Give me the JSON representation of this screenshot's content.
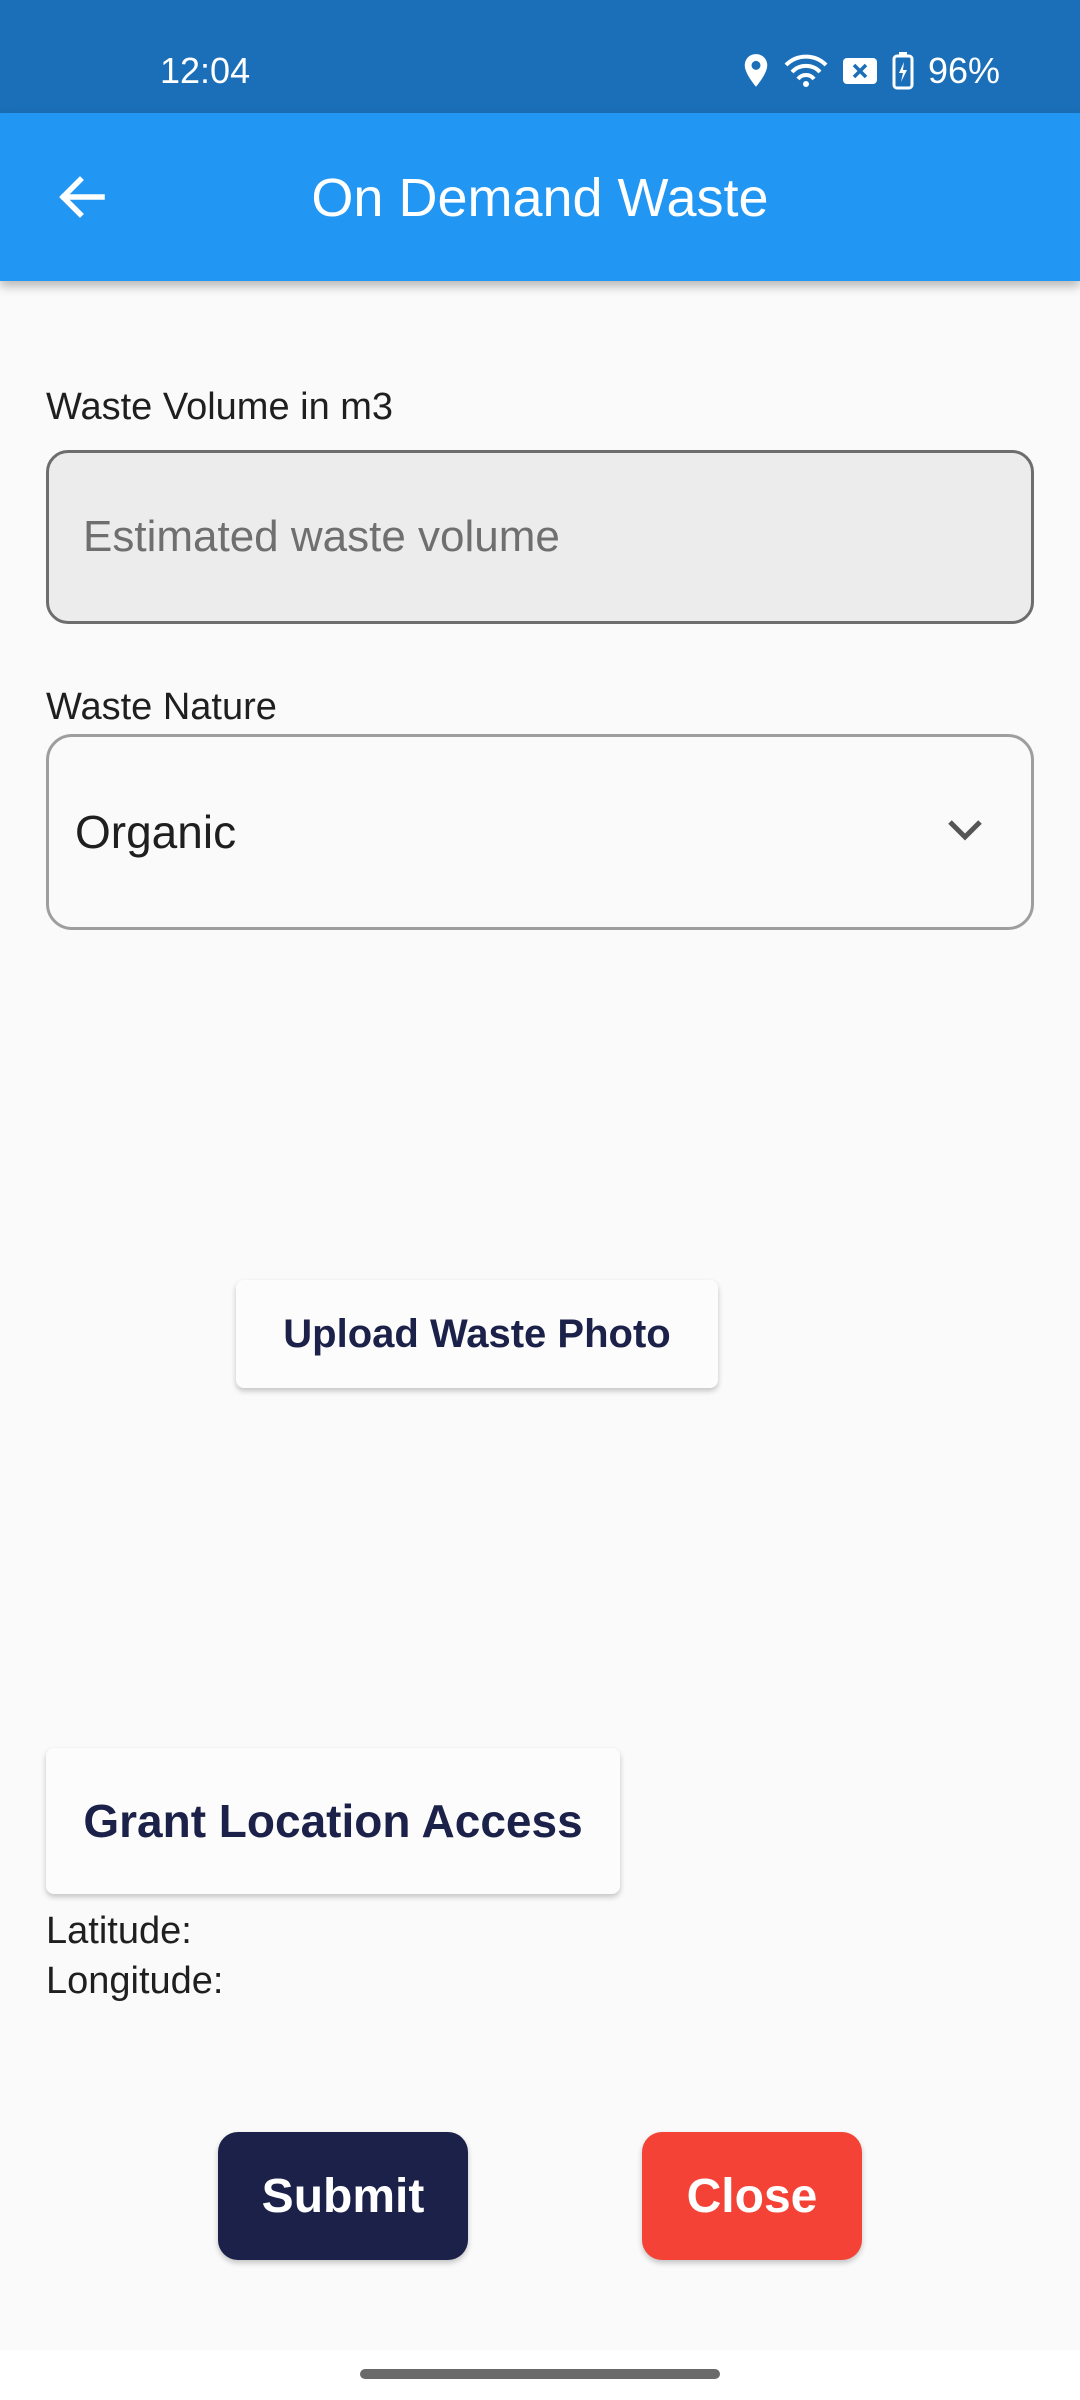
{
  "status_bar": {
    "time": "12:04",
    "battery": "96%",
    "icons": [
      "location-icon",
      "wifi-icon",
      "sim-error-icon",
      "battery-charging-icon"
    ]
  },
  "app_bar": {
    "title": "On Demand Waste",
    "back_icon": "arrow-back-icon"
  },
  "form": {
    "volume_label": "Waste Volume in m3",
    "volume_placeholder": "Estimated waste volume",
    "volume_value": "",
    "nature_label": "Waste Nature",
    "nature_value": "Organic",
    "upload_button": "Upload Waste Photo",
    "location_button": "Grant Location Access",
    "latitude_label": "Latitude:",
    "longitude_label": "Longitude:",
    "submit_button": "Submit",
    "close_button": "Close"
  },
  "colors": {
    "status_bar": "#1b6fb8",
    "app_bar": "#2196f3",
    "primary_dark": "#1b2149",
    "close_red": "#f44336"
  }
}
